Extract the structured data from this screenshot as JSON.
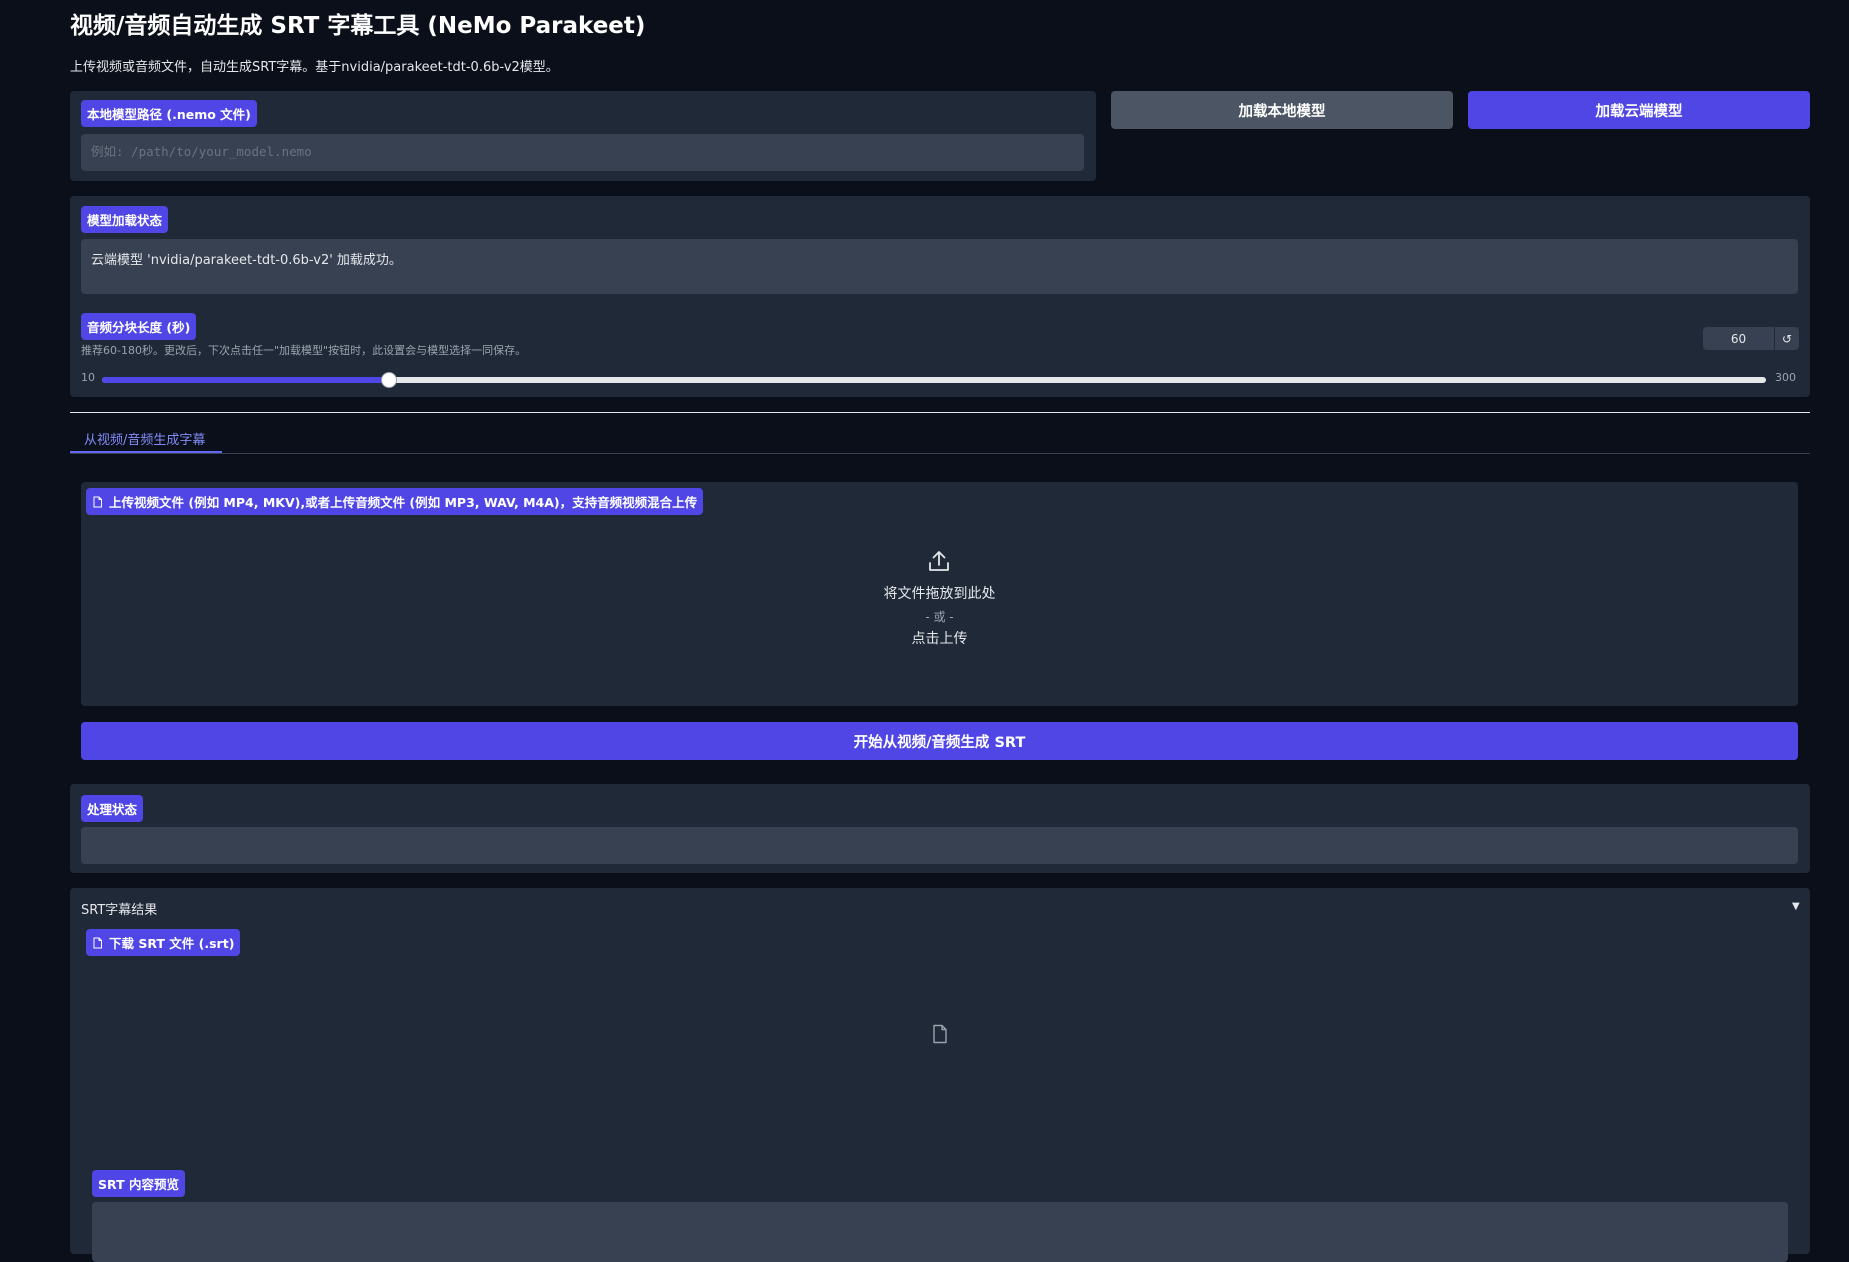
{
  "header": {
    "title": "视频/音频自动生成 SRT 字幕工具 (NeMo Parakeet)",
    "subtitle": "上传视频或音频文件，自动生成SRT字幕。基于nvidia/parakeet-tdt-0.6b-v2模型。"
  },
  "model_path": {
    "label": "本地模型路径 (.nemo 文件)",
    "placeholder": "例如: /path/to/your_model.nemo",
    "value": ""
  },
  "buttons": {
    "load_local": "加载本地模型",
    "load_cloud": "加载云端模型",
    "generate": "开始从视频/音频生成 SRT"
  },
  "model_status": {
    "label": "模型加载状态",
    "text": "云端模型 'nvidia/parakeet-tdt-0.6b-v2' 加载成功。"
  },
  "chunk": {
    "label": "音频分块长度 (秒)",
    "hint": "推荐60-180秒。更改后，下次点击任一\"加载模型\"按钮时，此设置会与模型选择一同保存。",
    "value": 60,
    "value_text": "60",
    "min": 10,
    "max": 300,
    "min_text": "10",
    "max_text": "300",
    "reset_icon": "↺"
  },
  "tabs": [
    {
      "label": "从视频/音频生成字幕",
      "active": true
    }
  ],
  "upload": {
    "label": "上传视频文件 (例如 MP4, MKV),或者上传音频文件 (例如 MP3, WAV, M4A)，支持音频视频混合上传",
    "drop_text": "将文件拖放到此处",
    "or_text": "- 或 -",
    "click_text": "点击上传"
  },
  "process_status": {
    "label": "处理状态",
    "text": ""
  },
  "results": {
    "title": "SRT字幕结果",
    "toggle": "▼",
    "download_label": "下载 SRT 文件 (.srt)",
    "preview_label": "SRT 内容预览",
    "preview_text": ""
  },
  "colors": {
    "background": "#0b0f19",
    "panel": "#1f2937",
    "input": "#374151",
    "accent": "#4f46e5",
    "secondary_button": "#4b5563"
  },
  "icons": {
    "file": "file-icon",
    "upload": "upload-icon",
    "reset": "reset-icon"
  }
}
